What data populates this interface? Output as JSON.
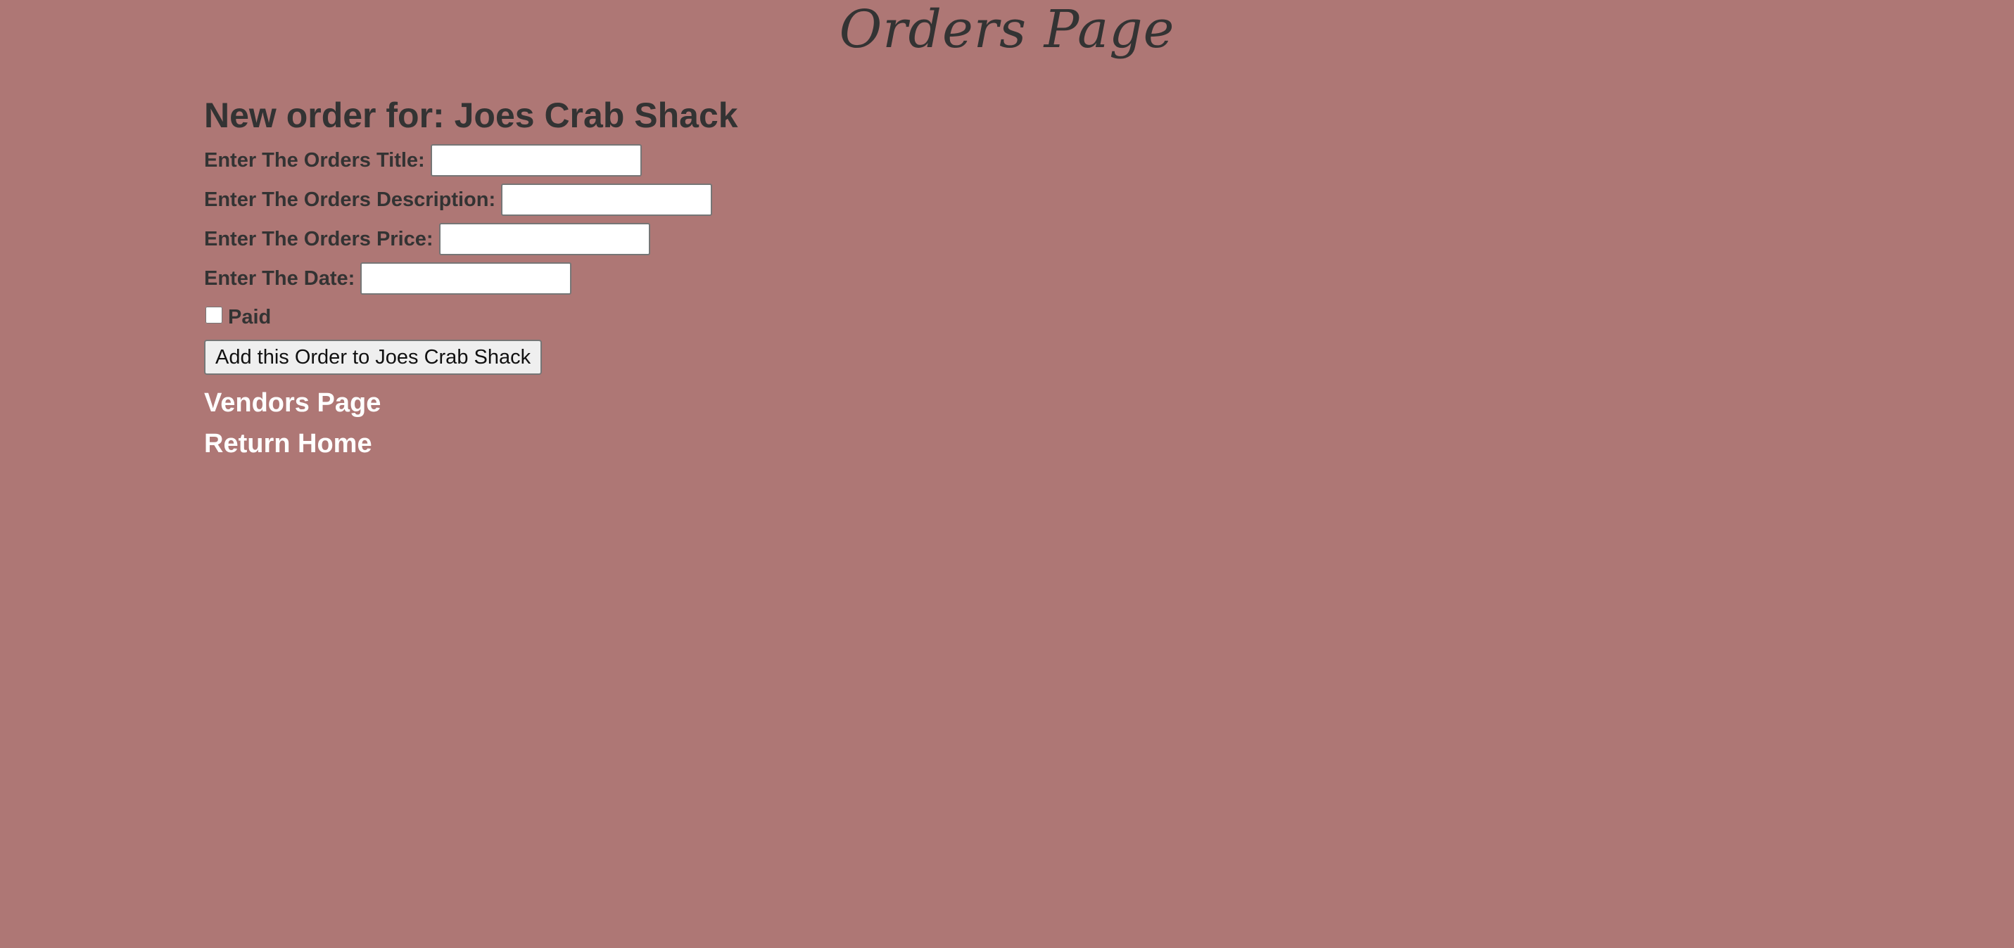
{
  "page": {
    "title": "Orders Page"
  },
  "order_form": {
    "heading": "New order for: Joes Crab Shack",
    "title_label": "Enter The Orders Title:",
    "title_value": "",
    "description_label": "Enter The Orders Description:",
    "description_value": "",
    "price_label": "Enter The Orders Price:",
    "price_value": "",
    "date_label": "Enter The Date:",
    "date_value": "",
    "paid_label": "Paid",
    "paid_checked": false,
    "submit_label": "Add this Order to Joes Crab Shack"
  },
  "nav": {
    "vendors_link": "Vendors Page",
    "home_link": "Return Home"
  },
  "colors": {
    "background": "#ae7775",
    "text": "#333333",
    "link": "#ffffff"
  }
}
